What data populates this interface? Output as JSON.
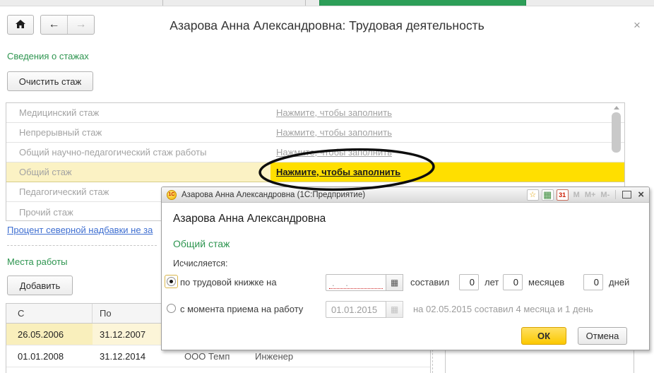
{
  "page": {
    "title": "Азарова Анна Александровна: Трудовая деятельность",
    "close_glyph": "×"
  },
  "nav": {
    "back_glyph": "←",
    "forward_glyph": "→"
  },
  "seniority": {
    "section_label": "Сведения о стажах",
    "clear_button": "Очистить стаж",
    "rows": [
      {
        "label": "Медицинский стаж",
        "link": "Нажмите, чтобы заполнить"
      },
      {
        "label": "Непрерывный стаж",
        "link": "Нажмите, чтобы заполнить"
      },
      {
        "label": "Общий научно-педагогический стаж работы",
        "link": "Нажмите, чтобы заполнить"
      },
      {
        "label": "Общий стаж",
        "link": "Нажмите, чтобы заполнить"
      },
      {
        "label": "Педагогический стаж"
      },
      {
        "label": "Прочий стаж"
      }
    ]
  },
  "north_allowance_link": "Процент северной надбавки не за",
  "workplaces": {
    "section_label": "Места работы",
    "add_button": "Добавить",
    "columns": {
      "from": "С",
      "to": "По"
    },
    "rows": [
      {
        "from": "26.05.2006",
        "to": "31.12.2007"
      },
      {
        "from": "01.01.2008",
        "to": "31.12.2014",
        "org": "ООО Темп",
        "position": "Инженер"
      }
    ]
  },
  "dialog": {
    "title": "Азарова Анна Александровна  (1С:Предприятие)",
    "titlebar": {
      "logo": "1С",
      "star_glyph": "☆",
      "calc_glyph": "▦",
      "calendar_day": "31",
      "mem1": "M",
      "mem2": "M+",
      "mem3": "M-",
      "close_glyph": "×"
    },
    "header": "Азарова Анна Александровна",
    "section_title": "Общий стаж",
    "calc_label": "Исчисляется:",
    "option_workbook": {
      "label": "по трудовой книжке на",
      "date_mask": ".  .",
      "picker_glyph": "▦",
      "result_label": "составил",
      "years_value": "0",
      "years_label": "лет",
      "months_value": "0",
      "months_label": "месяцев",
      "days_value": "0",
      "days_label": "дней"
    },
    "option_hire": {
      "label": "с момента приема на работу",
      "date_value": "01.01.2015",
      "picker_glyph": "▦",
      "note": "на 02.05.2015 составил 4 месяца и 1 день"
    },
    "ok_button": "ОК",
    "cancel_button": "Отмена"
  },
  "colors": {
    "accent_green": "#2E9550",
    "tab_green": "#2D9E58",
    "highlight_yellow": "#FFDF00",
    "pale_yellow": "#FBF2C4",
    "link_blue": "#3F6FD1"
  }
}
